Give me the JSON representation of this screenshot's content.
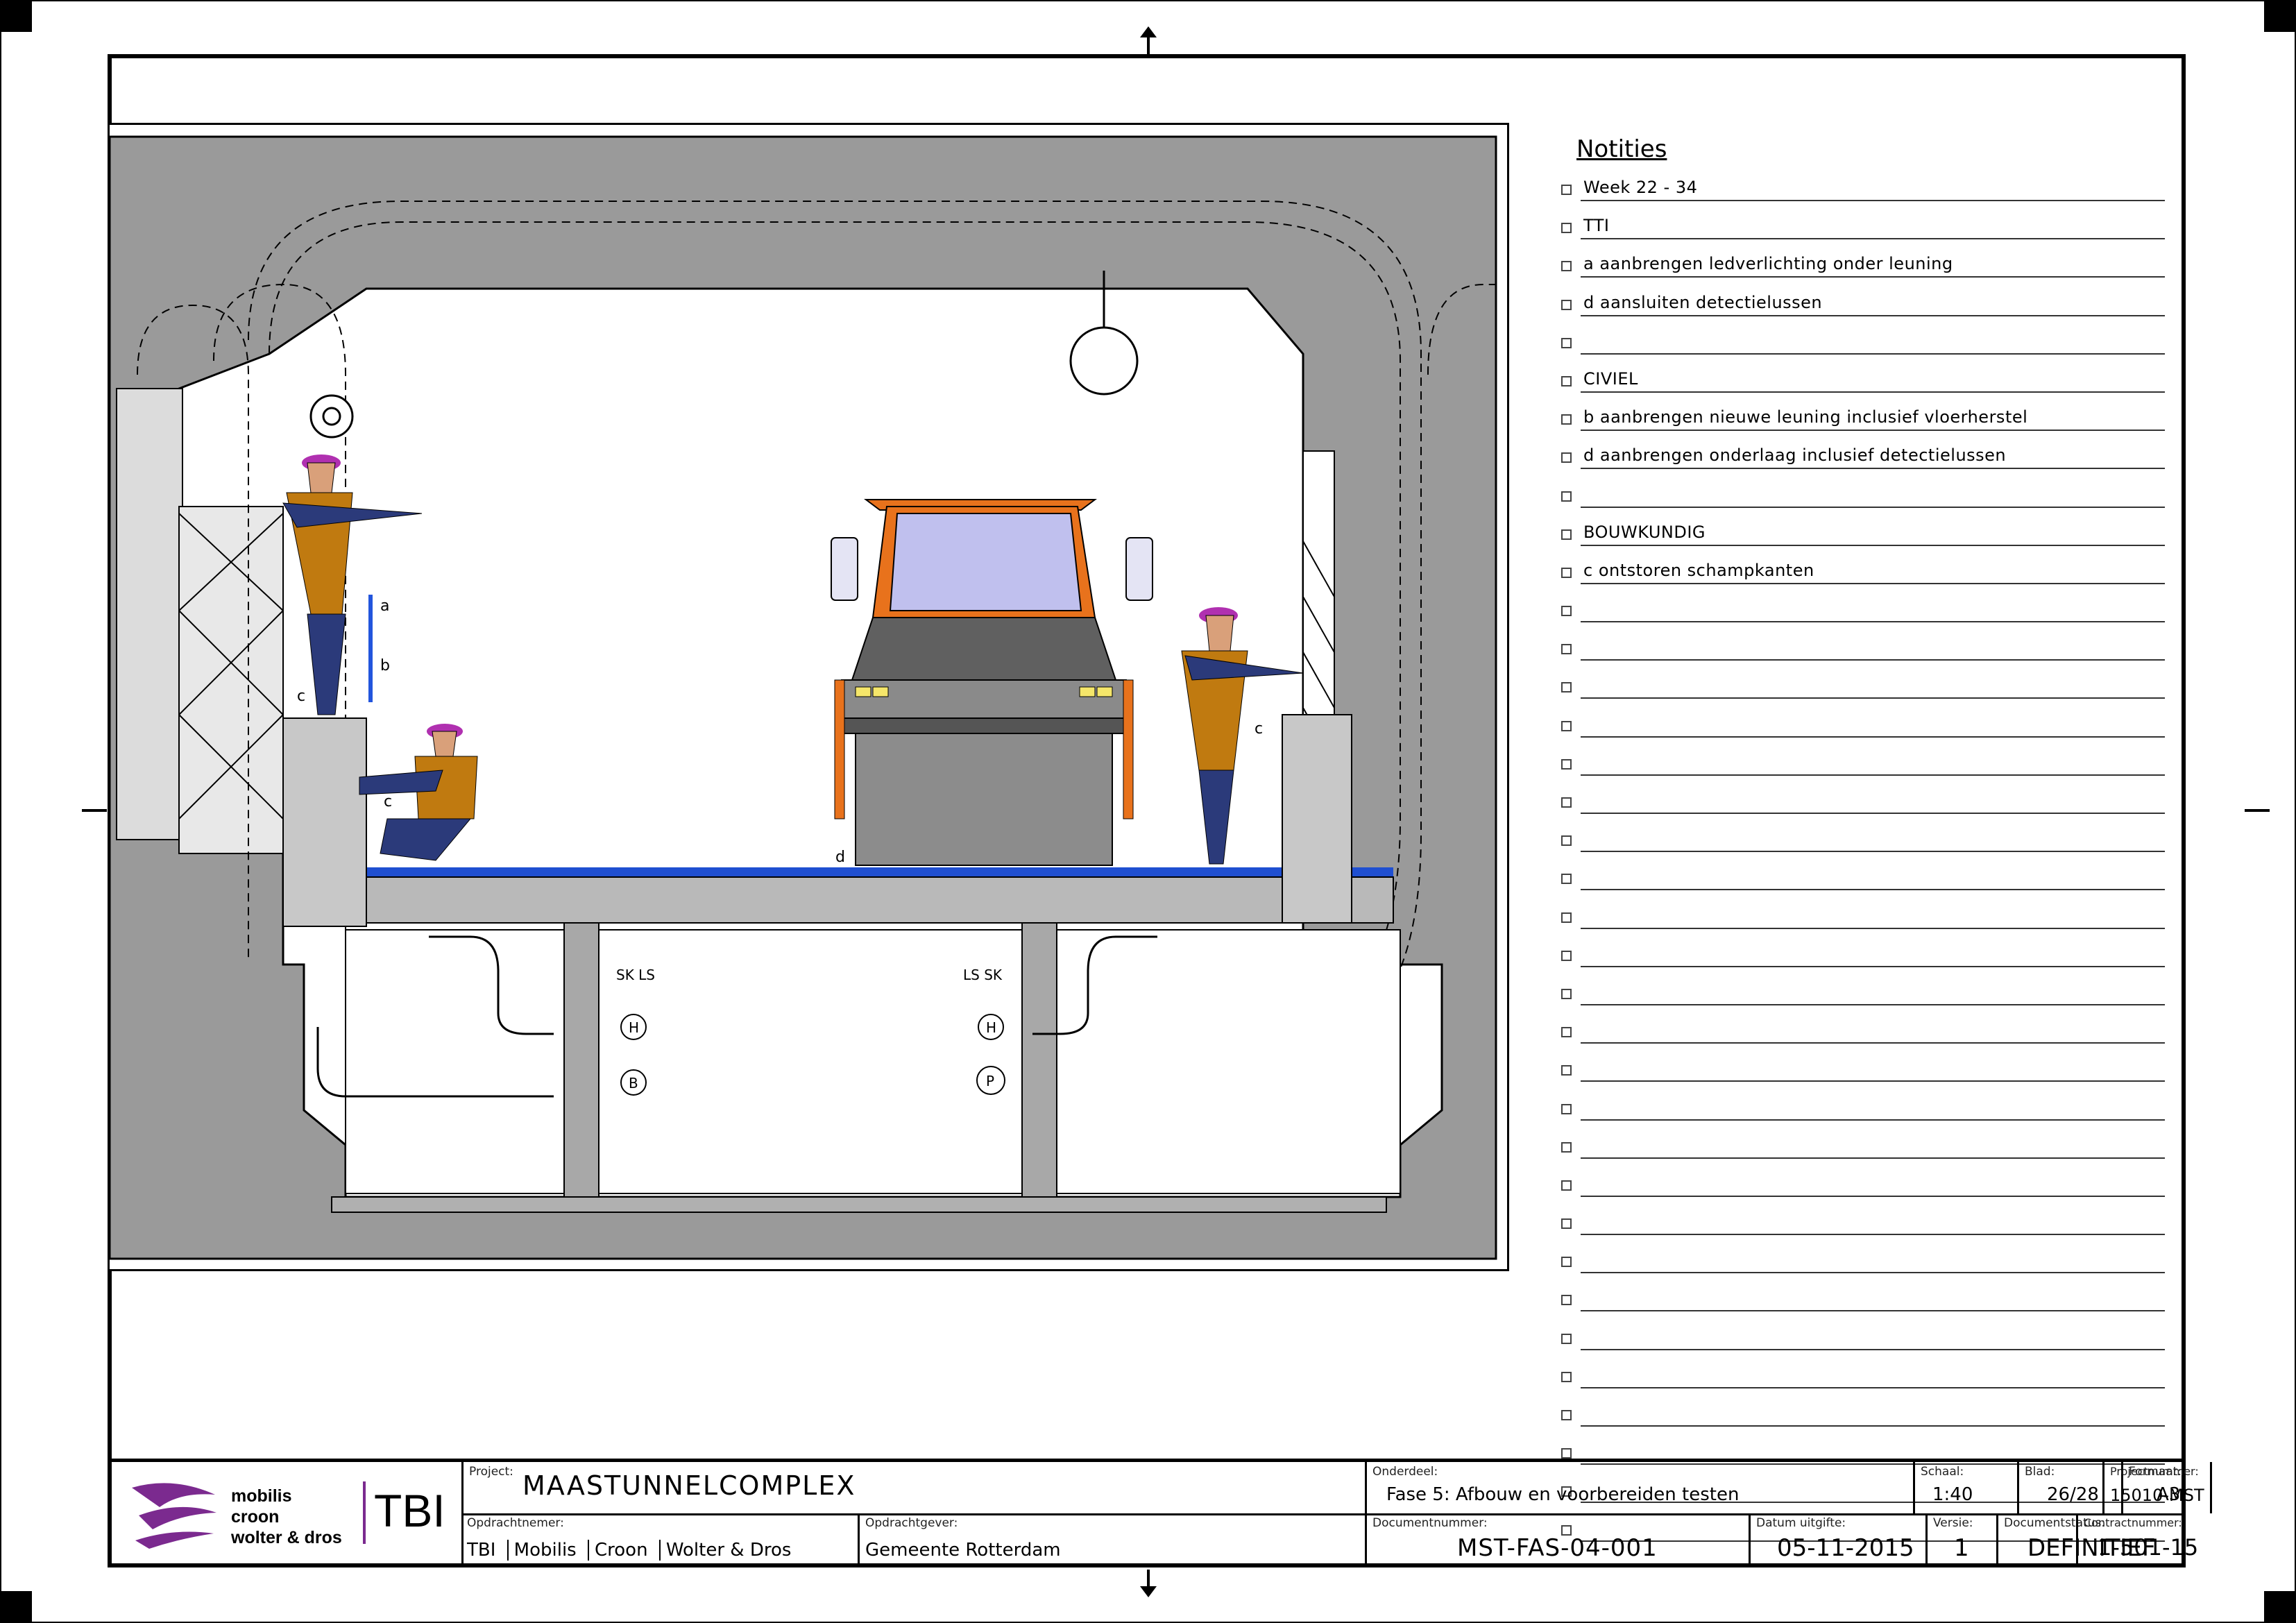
{
  "notes": {
    "title": "Notities",
    "items": [
      "Week 22 - 34",
      "TTI",
      "a aanbrengen ledverlichting onder leuning",
      "d aansluiten detectielussen",
      "",
      "CIVIEL",
      "b aanbrengen nieuwe leuning inclusief vloerherstel",
      "d aanbrengen onderlaag inclusief detectielussen",
      "",
      "BOUWKUNDIG",
      "c ontstoren schampkanten",
      "",
      "",
      "",
      "",
      "",
      "",
      "",
      "",
      "",
      "",
      "",
      "",
      "",
      "",
      "",
      "",
      "",
      "",
      "",
      "",
      "",
      "",
      "",
      "",
      ""
    ]
  },
  "drawing": {
    "labels": {
      "a": "a",
      "b": "b",
      "c1": "c",
      "c2": "c",
      "c3": "c",
      "d": "d",
      "sk_ls_left": "SK LS",
      "ls_sk_right": "LS SK",
      "h_left": "H",
      "b_left": "B",
      "h_right": "H",
      "p_right": "P"
    },
    "colors": {
      "tunnel_gray": "#9a9a9a",
      "vest_orange": "#c07a10",
      "helmet_magenta": "#b030b0",
      "pants_navy": "#2b3a7a",
      "railing_blue": "#2255dd",
      "truck_orange": "#e8721c",
      "truck_body": "#8a8a8a",
      "windshield": "#c0c0ee"
    }
  },
  "titleblock": {
    "logo_lines": [
      "mobilis",
      "croon",
      "wolter & dros"
    ],
    "logo_tbi": "TBI",
    "project_label": "Project:",
    "project": "MAASTUNNELCOMPLEX",
    "contractor_label": "Opdrachtnemer:",
    "contractor": [
      "TBI",
      "Mobilis",
      "Croon",
      "Wolter & Dros"
    ],
    "client_label": "Opdrachtgever:",
    "client": "Gemeente Rotterdam",
    "part_label": "Onderdeel:",
    "part": "Fase 5: Afbouw en voorbereiden testen",
    "docnum_label": "Documentnummer:",
    "docnum": "MST-FAS-04-001",
    "date_label": "Datum uitgifte:",
    "date": "05-11-2015",
    "scale_label": "Schaal:",
    "scale": "1:40",
    "sheet_label": "Blad:",
    "sheet": "26/28",
    "format_label": "Formaat:",
    "format": "A3",
    "projnum_label": "Projectnummer:",
    "projnum": "15010-MST",
    "version_label": "Versie:",
    "version": "1",
    "status_label": "Documentstatus:",
    "status": "DEFINITIEF",
    "contract_label": "Contractnummer:",
    "contract": "1-501-15"
  }
}
